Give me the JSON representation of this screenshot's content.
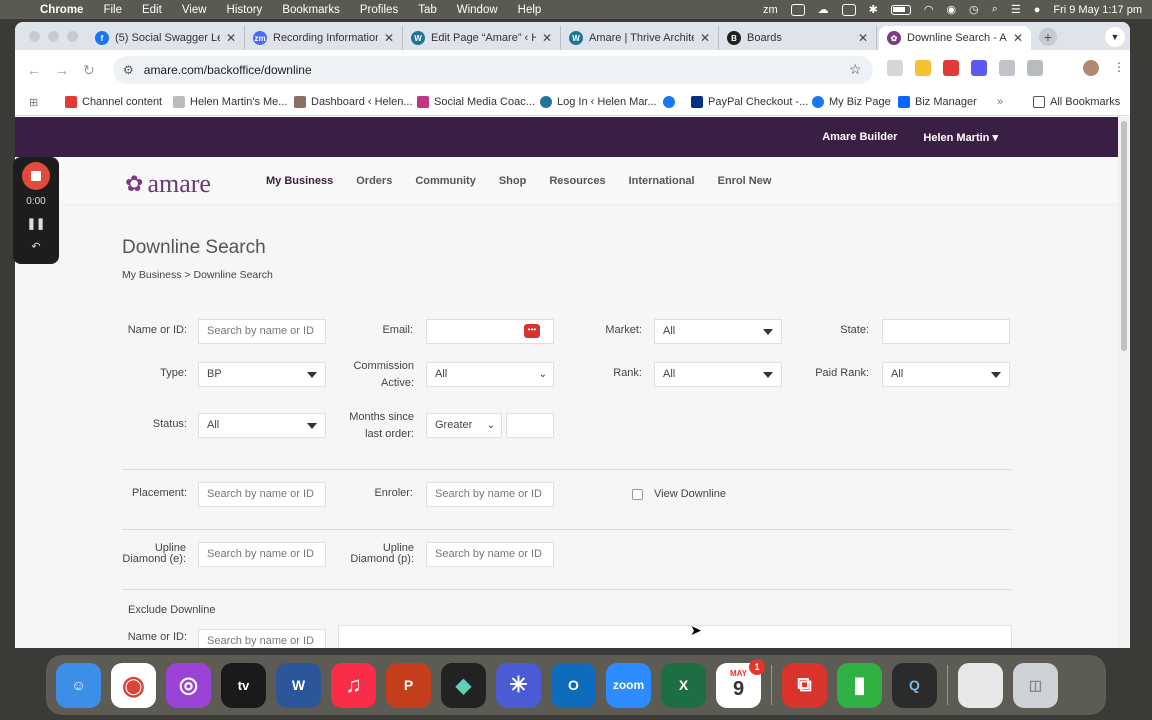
{
  "menubar": {
    "items": [
      "Chrome",
      "File",
      "Edit",
      "View",
      "History",
      "Bookmarks",
      "Profiles",
      "Tab",
      "Window",
      "Help"
    ],
    "datetime": "Fri 9 May  1:17 pm"
  },
  "tabs": [
    {
      "title": "(5) Social Swagger Le",
      "color": "#1877f2",
      "glyph": "f"
    },
    {
      "title": "Recording Information",
      "color": "#4a6cf7",
      "glyph": "zm"
    },
    {
      "title": "Edit Page “Amare” ‹ H",
      "color": "#21759b",
      "glyph": "W"
    },
    {
      "title": "Amare | Thrive Archite",
      "color": "#21759b",
      "glyph": "W"
    },
    {
      "title": "Boards",
      "color": "#222",
      "glyph": "B"
    },
    {
      "title": "Downline Search - Am",
      "color": "#7a3d84",
      "glyph": "✿"
    }
  ],
  "url": "amare.com/backoffice/downline",
  "bookmarks": [
    {
      "label": "Channel content",
      "color": "#e53935"
    },
    {
      "label": "Helen Martin's Me...",
      "color": "#999"
    },
    {
      "label": "Dashboard ‹ Helen...",
      "color": "#8d6e63"
    },
    {
      "label": "Social Media Coac...",
      "color": "#c13584"
    },
    {
      "label": "Log In ‹ Helen Mar...",
      "color": "#21759b"
    },
    {
      "label": "",
      "color": "#1877f2"
    },
    {
      "label": "PayPal Checkout -...",
      "color": "#003087"
    },
    {
      "label": "My Biz Page",
      "color": "#1877f2"
    },
    {
      "label": "Biz Manager",
      "color": "#0866ff"
    },
    {
      "label": "All Bookmarks",
      "color": "#555"
    }
  ],
  "site": {
    "top_links": [
      "Amare Builder",
      "Helen Martin"
    ],
    "logo": "amare",
    "nav": [
      "My Business",
      "Orders",
      "Community",
      "Shop",
      "Resources",
      "International",
      "Enrol New"
    ],
    "title": "Downline Search",
    "breadcrumb": "My Business > Downline Search"
  },
  "form": {
    "name_label": "Name or ID:",
    "name_ph": "Search by name or ID",
    "email_label": "Email:",
    "market_label": "Market:",
    "market_val": "All",
    "state_label": "State:",
    "type_label": "Type:",
    "type_val": "BP",
    "commission_label_1": "Commission",
    "commission_label_2": "Active:",
    "commission_val": "All",
    "rank_label": "Rank:",
    "rank_val": "All",
    "paid_rank_label": "Paid Rank:",
    "paid_rank_val": "All",
    "status_label": "Status:",
    "status_val": "All",
    "months_label_1": "Months since",
    "months_label_2": "last order:",
    "months_val": "Greater",
    "placement_label": "Placement:",
    "placement_ph": "Search by name or ID",
    "enroler_label": "Enroler:",
    "enroler_ph": "Search by name or ID",
    "view_downline": "View Downline",
    "upline_e_1": "Upline",
    "upline_e_2": "Diamond (e):",
    "upline_e_ph": "Search by name or ID",
    "upline_p_1": "Upline",
    "upline_p_2": "Diamond (p):",
    "upline_p_ph": "Search by name or ID",
    "exclude_title": "Exclude Downline",
    "ex_name_label": "Name or ID:",
    "ex_name_ph": "Search by name or ID"
  },
  "recorder": {
    "time": "0:00"
  },
  "dock": [
    {
      "name": "finder",
      "color": "#3d8ee6",
      "glyph": "☺"
    },
    {
      "name": "chrome",
      "color": "#ffffff",
      "glyph": "◉"
    },
    {
      "name": "podcasts",
      "color": "#9b43d6",
      "glyph": "◎"
    },
    {
      "name": "apple-tv",
      "color": "#1a1a1a",
      "glyph": "tv"
    },
    {
      "name": "word",
      "color": "#2b579a",
      "glyph": "W"
    },
    {
      "name": "music",
      "color": "#fa2d48",
      "glyph": "♫"
    },
    {
      "name": "powerpoint",
      "color": "#c43e1c",
      "glyph": "P"
    },
    {
      "name": "capcut",
      "color": "#222",
      "glyph": "◆"
    },
    {
      "name": "perplexity",
      "color": "#4a5bd4",
      "glyph": "✳"
    },
    {
      "name": "outlook",
      "color": "#0f6cbd",
      "glyph": "O"
    },
    {
      "name": "zoom",
      "color": "#2d8cff",
      "glyph": "zoom"
    },
    {
      "name": "excel",
      "color": "#1d6f42",
      "glyph": "X"
    },
    {
      "name": "calendar",
      "color": "#ffffff",
      "glyph": "9",
      "badge": "1",
      "month": "MAY"
    },
    {
      "name": "parallels",
      "color": "#d9342b",
      "glyph": "⧉"
    },
    {
      "name": "numbers",
      "color": "#2fb143",
      "glyph": "▮"
    },
    {
      "name": "quicktime",
      "color": "#2b2b2b",
      "glyph": "Q"
    },
    {
      "name": "document",
      "color": "#e8e8e8",
      "glyph": ""
    },
    {
      "name": "trash",
      "color": "#cfd3d6",
      "glyph": "🗑"
    }
  ]
}
